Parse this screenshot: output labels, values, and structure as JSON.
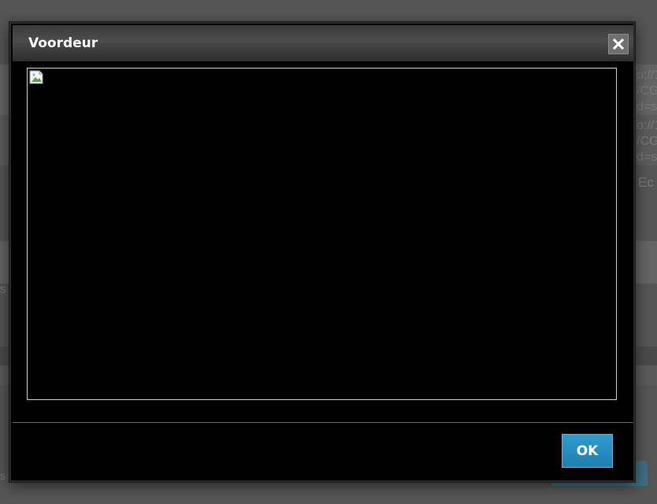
{
  "background": {
    "url_fragment_1": "o://1\n/CG\nd=s",
    "url_fragment_2": "o://1\n/CG\nd=s",
    "text_fragment_3": "Ec",
    "text_fragment_4": "s",
    "text_fragment_5": "s"
  },
  "dialog": {
    "title": "Voordeur",
    "close_icon": "close-icon",
    "image_icon": "broken-image-icon",
    "ok_label": "OK"
  },
  "colors": {
    "dialog_background": "#000000",
    "titlebar": "#3a3a3a",
    "ok_button": "#2f9ccf",
    "backdrop": "#555555"
  }
}
